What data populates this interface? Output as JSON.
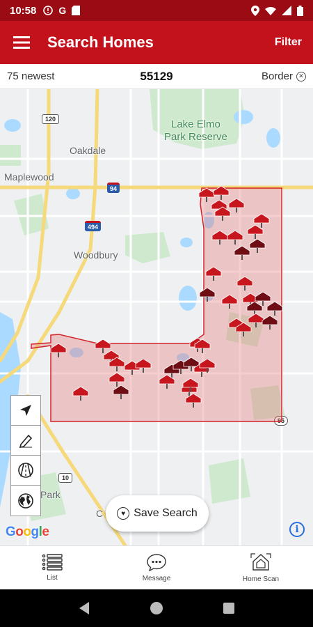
{
  "status_bar": {
    "time": "10:58",
    "left_icons": [
      "alert-icon",
      "google-icon",
      "sd-card-icon"
    ],
    "right_icons": [
      "location-icon",
      "wifi-icon",
      "signal-icon",
      "battery-icon"
    ]
  },
  "app_bar": {
    "title": "Search Homes",
    "filter_label": "Filter",
    "menu_icon": "hamburger-menu-icon"
  },
  "info_bar": {
    "left_text": "75 newest",
    "center_text": "55129",
    "right_text": "Border",
    "clear_icon": "close-circle-icon"
  },
  "map": {
    "labels": {
      "lake_elmo": "Lake Elmo\nPark Reserve",
      "oakdale": "Oakdale",
      "maplewood": "Maplewood",
      "woodbury": "Woodbury",
      "park": "Park",
      "c": "C"
    },
    "shields": {
      "hwy_120": "120",
      "i_94": "94",
      "i_494": "494",
      "hwy_95": "95",
      "hwy_10": "10"
    },
    "tools": [
      "navigation-arrow-icon",
      "draw-pencil-icon",
      "road-view-icon",
      "globe-icon"
    ],
    "save_search_label": "Save Search",
    "google_logo": "Google",
    "info_icon": "i"
  },
  "bottom_nav": [
    {
      "label": "List",
      "icon": "list-icon"
    },
    {
      "label": "Message",
      "icon": "message-icon"
    },
    {
      "label": "Home Scan",
      "icon": "home-scan-icon"
    }
  ],
  "system_nav": [
    "back-icon",
    "home-icon",
    "recents-icon"
  ],
  "colors": {
    "status_bar": "#9b0b14",
    "app_bar": "#c4121c",
    "border_region": "#e57373",
    "pin_red": "#c8161e",
    "pin_dark": "#6e0d14"
  }
}
